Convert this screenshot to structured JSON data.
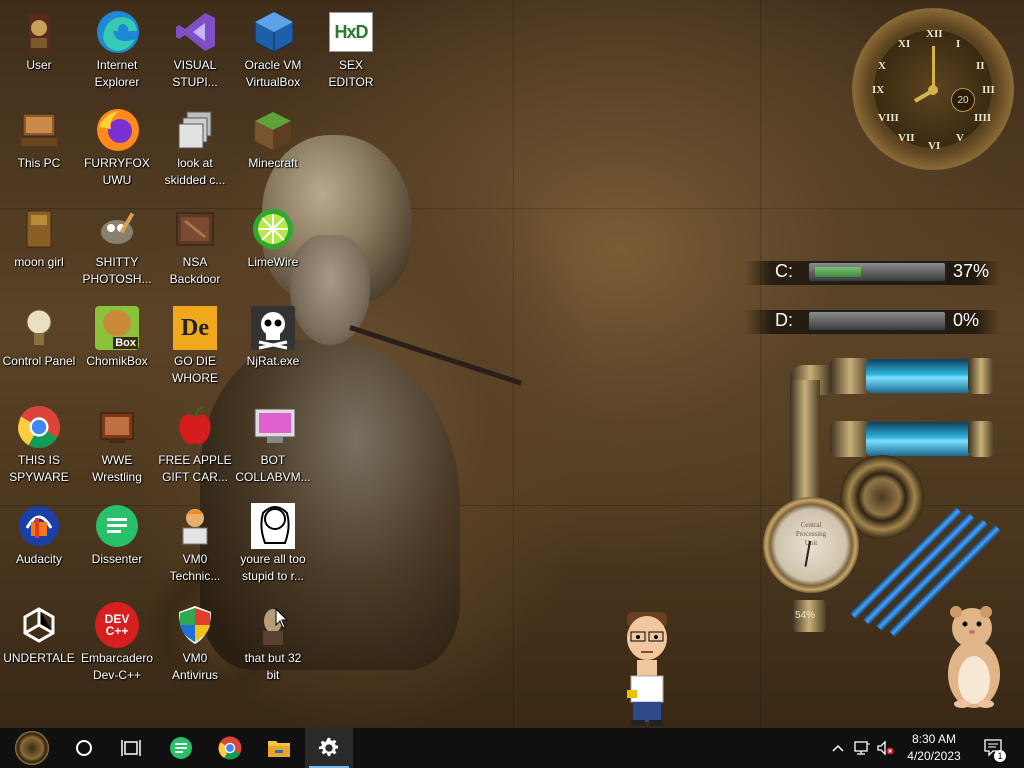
{
  "desktop_icons": [
    {
      "label": "User"
    },
    {
      "label": "Internet\nExplorer"
    },
    {
      "label": "VISUAL\nSTUPI..."
    },
    {
      "label": "Oracle VM\nVirtualBox"
    },
    {
      "label": "SEX\nEDITOR"
    },
    {
      "label": "This PC"
    },
    {
      "label": "FURRYFOX\nUWU"
    },
    {
      "label": "look at\nskidded c..."
    },
    {
      "label": "Minecraft"
    },
    {
      "label": "moon girl"
    },
    {
      "label": "SHITTY\nPHOTOSH..."
    },
    {
      "label": "NSA\nBackdoor"
    },
    {
      "label": "LimeWire"
    },
    {
      "label": "Control Panel"
    },
    {
      "label": "ChomikBox"
    },
    {
      "label": "GO DIE\nWHORE"
    },
    {
      "label": "NjRat.exe"
    },
    {
      "label": "THIS IS\nSPYWARE"
    },
    {
      "label": "WWE\nWrestling"
    },
    {
      "label": "FREE APPLE\nGIFT CAR..."
    },
    {
      "label": "BOT\nCOLLABVM..."
    },
    {
      "label": "Audacity"
    },
    {
      "label": "Dissenter"
    },
    {
      "label": "VM0\nTechnic..."
    },
    {
      "label": "youre all too\nstupid to r..."
    },
    {
      "label": "UNDERTALE"
    },
    {
      "label": "Embarcadero\nDev-C++"
    },
    {
      "label": "VM0\nAntivirus"
    },
    {
      "label": "that but 32\nbit"
    }
  ],
  "icon_glyphs": {
    "box": "Box",
    "de": "De",
    "devcpp": "DEV\nC++",
    "hxd": "HxD"
  },
  "clock_widget": {
    "numerals": [
      "XII",
      "I",
      "II",
      "III",
      "IIII",
      "V",
      "VI",
      "VII",
      "VIII",
      "IX",
      "X",
      "XI"
    ],
    "date_day": "20"
  },
  "disk_meters": [
    {
      "letter": "C:",
      "percent_label": "37%",
      "fill_fraction": 0.37
    },
    {
      "letter": "D:",
      "percent_label": "0%",
      "fill_fraction": 0.0
    }
  ],
  "cpu_gauge": {
    "text": "Central\nProcessing\nUnit",
    "reading": "54%"
  },
  "taskbar": {
    "items": [
      "start-button",
      "cortana-button",
      "task-view-button",
      "dissenter-taskbar",
      "chrome-taskbar",
      "file-explorer-taskbar",
      "settings-taskbar"
    ],
    "clock_time": "8:30 AM",
    "clock_date": "4/20/2023",
    "notification_count": "1"
  },
  "colors": {
    "taskbar_bg": "#101010",
    "accent": "#76b9ed"
  }
}
